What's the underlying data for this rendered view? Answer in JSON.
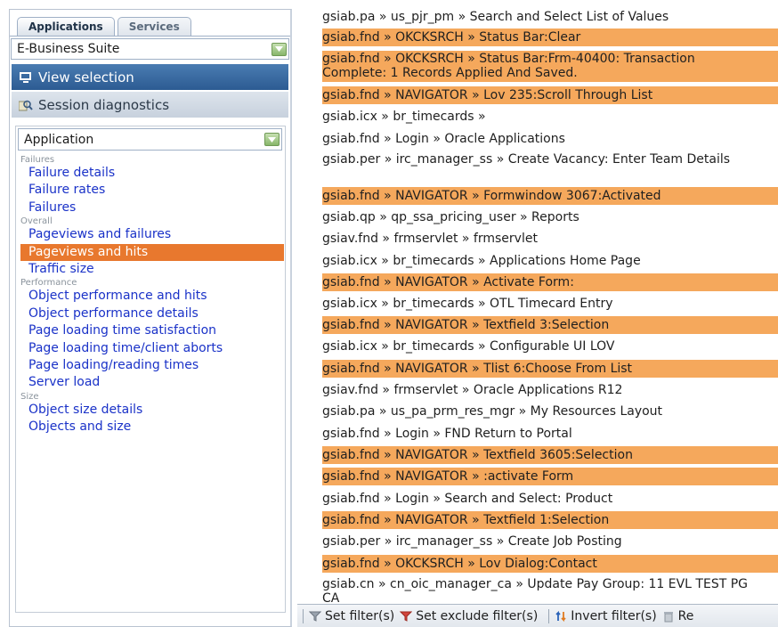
{
  "tabs": [
    {
      "label": "Applications",
      "active": true
    },
    {
      "label": "Services",
      "active": false
    }
  ],
  "suite_select": {
    "value": "E-Business Suite",
    "icon": "chevron-down-icon"
  },
  "view_selection": {
    "label": "View selection",
    "icon": "monitor-icon"
  },
  "session_diagnostics": {
    "label": "Session diagnostics",
    "icon": "magnifier-icon"
  },
  "app_select": {
    "value": "Application",
    "icon": "chevron-down-icon"
  },
  "nav": {
    "groups": [
      {
        "heading": "Failures",
        "items": [
          "Failure details",
          "Failure rates",
          "Failures"
        ]
      },
      {
        "heading": "Overall",
        "items": [
          "Pageviews and failures",
          "Pageviews and hits",
          "Traffic size"
        ]
      },
      {
        "heading": "Performance",
        "items": [
          "Object performance and hits",
          "Object performance details",
          "Page loading time satisfaction",
          "Page loading time/client aborts",
          "Page loading/reading times",
          "Server load"
        ]
      },
      {
        "heading": "Size",
        "items": [
          "Object size details",
          "Objects and size"
        ]
      }
    ],
    "selected": "Pageviews and hits"
  },
  "colors": {
    "highlight": "#f5a85c",
    "selected_nav": "#e8782e",
    "link": "#1a32c8",
    "header_blue": "#2c5b92"
  },
  "list": [
    {
      "text": "gsiab.pa » us_pjr_pm » Search and Select List of Values",
      "highlighted": false
    },
    {
      "text": "gsiab.fnd » OKCKSRCH » Status Bar:Clear",
      "highlighted": true
    },
    {
      "text": "gsiab.fnd » OKCKSRCH » Status Bar:Frm-40400: Transaction Complete: 1 Records Applied And Saved.",
      "highlighted": true
    },
    {
      "text": "gsiab.fnd » NAVIGATOR » Lov 235:Scroll Through List",
      "highlighted": true
    },
    {
      "text": "gsiab.icx » br_timecards »",
      "highlighted": false
    },
    {
      "text": "gsiab.fnd » Login » Oracle Applications",
      "highlighted": false
    },
    {
      "text": "gsiab.per » irc_manager_ss » Create Vacancy: Enter Team Details",
      "highlighted": false
    },
    {
      "text": "gsiab.fnd » NAVIGATOR » Formwindow 3067:Activated",
      "highlighted": true
    },
    {
      "text": "gsiab.qp » qp_ssa_pricing_user » Reports",
      "highlighted": false
    },
    {
      "text": "gsiav.fnd » frmservlet » frmservlet",
      "highlighted": false
    },
    {
      "text": "gsiab.icx » br_timecards » Applications Home Page",
      "highlighted": false
    },
    {
      "text": "gsiab.fnd » NAVIGATOR » Activate Form:",
      "highlighted": true
    },
    {
      "text": "gsiab.icx » br_timecards » OTL Timecard Entry",
      "highlighted": false
    },
    {
      "text": "gsiab.fnd » NAVIGATOR » Textfield 3:Selection",
      "highlighted": true
    },
    {
      "text": "gsiab.icx » br_timecards » Configurable UI LOV",
      "highlighted": false
    },
    {
      "text": "gsiab.fnd » NAVIGATOR » Tlist 6:Choose From List",
      "highlighted": true
    },
    {
      "text": "gsiav.fnd » frmservlet » Oracle Applications R12",
      "highlighted": false
    },
    {
      "text": "gsiab.pa » us_pa_prm_res_mgr » My Resources Layout",
      "highlighted": false
    },
    {
      "text": "gsiab.fnd » Login » FND Return to Portal",
      "highlighted": false
    },
    {
      "text": "gsiab.fnd » NAVIGATOR » Textfield 3605:Selection",
      "highlighted": true
    },
    {
      "text": "gsiab.fnd » NAVIGATOR » :activate Form",
      "highlighted": true
    },
    {
      "text": "gsiab.fnd » Login » Search and Select: Product",
      "highlighted": false
    },
    {
      "text": "gsiab.fnd » NAVIGATOR » Textfield 1:Selection",
      "highlighted": true
    },
    {
      "text": "gsiab.per » irc_manager_ss » Create Job Posting",
      "highlighted": false
    },
    {
      "text": "gsiab.fnd » OKCKSRCH » Lov Dialog:Contact",
      "highlighted": true
    },
    {
      "text": "gsiab.cn » cn_oic_manager_ca » Update Pay Group: 11 EVL TEST PG CA",
      "highlighted": false
    }
  ],
  "toolbar": {
    "set_filter": {
      "label": "Set filter(s)",
      "icon": "funnel-icon"
    },
    "set_exclude_filter": {
      "label": "Set exclude filter(s)",
      "icon": "funnel-exclude-icon"
    },
    "invert_filter": {
      "label": "Invert filter(s)",
      "icon": "invert-arrows-icon"
    },
    "remove": {
      "label": "Re",
      "icon": "trash-icon"
    }
  }
}
